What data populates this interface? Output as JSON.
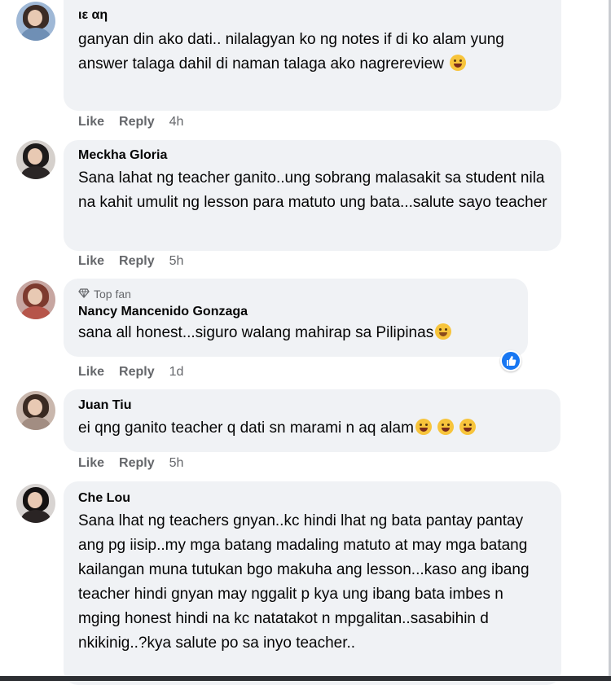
{
  "actions": {
    "like": "Like",
    "reply": "Reply"
  },
  "comments": [
    {
      "author": "ιε αη",
      "text": "ganyan din ako dati.. nilalagyan ko ng notes if di ko alam yung answer talaga dahil di naman talaga ako nagrereview",
      "time": "4h",
      "emoji": "laughing-face",
      "avatar_colors": {
        "bg": "#9fb8d6",
        "hair": "#3b2b25",
        "body": "#6f8fb5"
      }
    },
    {
      "author": "Meckha Gloria",
      "text": "Sana lahat ng teacher ganito..ung sobrang malasakit sa student nila na kahit umulit ng lesson para matuto ung bata...salute sayo teacher",
      "time": "5h",
      "avatar_colors": {
        "bg": "#d5d0cc",
        "hair": "#1d1a1a",
        "body": "#2b2626"
      }
    },
    {
      "author": "Nancy Mancenido Gonzaga",
      "badge": "Top fan",
      "text": "sana all honest...siguro walang mahirap sa Pilipinas",
      "time": "1d",
      "emoji": "smiling-face",
      "reaction": "like-icon",
      "avatar_colors": {
        "bg": "#c7a6a1",
        "hair": "#7d3a2e",
        "body": "#b6554a"
      }
    },
    {
      "author": "Juan Tiu",
      "text": "ei qng ganito teacher q dati sn marami n aq alam",
      "time": "5h",
      "emoji": "grinning-face",
      "avatar_colors": {
        "bg": "#c9b7ad",
        "hair": "#3a2a22",
        "body": "#a28d82"
      }
    },
    {
      "author": "Che Lou",
      "text": "Sana lhat ng teachers gnyan..kc hindi lhat ng bata pantay pantay ang pg iisip..my mga batang madaling matuto at may mga batang kailangan muna tutukan bgo makuha ang lesson...kaso ang ibang teacher hindi gnyan may nggalit p kya ung ibang bata imbes n mging honest hindi na kc natatakot n mpgalitan..sasabihin d nkikinig..?kya salute po sa inyo teacher..",
      "avatar_colors": {
        "bg": "#d8d4d2",
        "hair": "#141212",
        "body": "#2a2424"
      }
    }
  ],
  "colors": {
    "bubble": "#f0f2f5",
    "meta": "#65676b",
    "like_blue": "#1877f2"
  }
}
